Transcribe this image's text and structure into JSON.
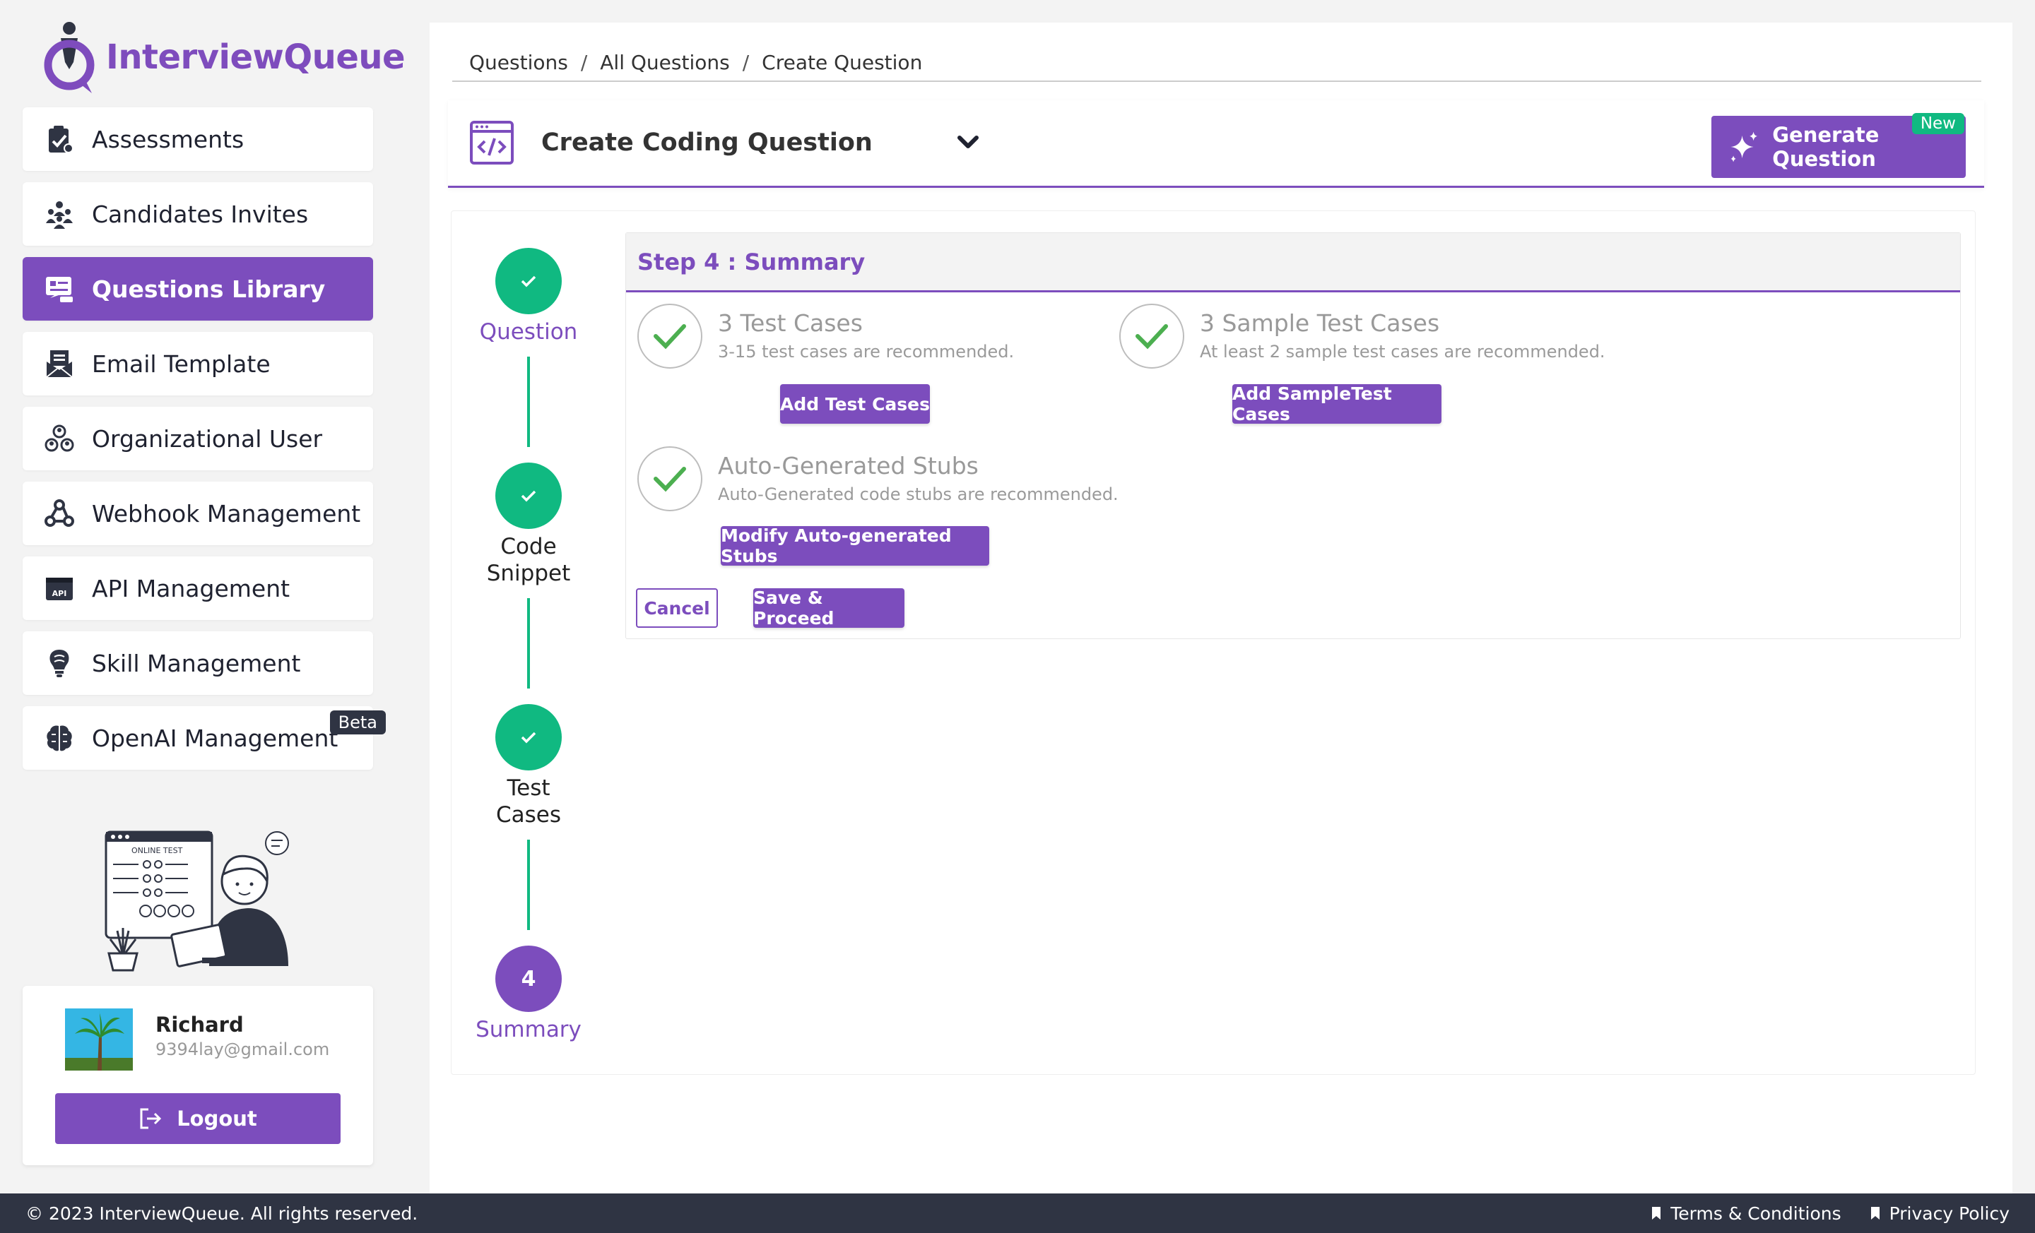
{
  "app": {
    "name": "InterviewQueue",
    "brand_color": "#7c4dbd",
    "success_color": "#10b981"
  },
  "sidebar": {
    "items": [
      {
        "label": "Assessments",
        "icon": "clipboard-check-icon"
      },
      {
        "label": "Candidates Invites",
        "icon": "people-group-icon"
      },
      {
        "label": "Questions Library",
        "icon": "question-list-icon",
        "active": true
      },
      {
        "label": "Email Template",
        "icon": "mail-icon"
      },
      {
        "label": "Organizational User",
        "icon": "org-users-icon"
      },
      {
        "label": "Webhook Management",
        "icon": "webhook-icon"
      },
      {
        "label": "API Management",
        "icon": "api-icon"
      },
      {
        "label": "Skill Management",
        "icon": "lightbulb-brain-icon"
      },
      {
        "label": "OpenAI Management",
        "icon": "openai-brain-icon",
        "badge": "Beta"
      }
    ],
    "illustration_text": "ONLINE TEST"
  },
  "user": {
    "name": "Richard",
    "email": "9394lay@gmail.com",
    "logout_label": "Logout"
  },
  "breadcrumb": [
    "Questions",
    "All Questions",
    "Create Question"
  ],
  "header": {
    "title": "Create Coding Question",
    "generate_label": "Generate Question",
    "new_badge": "New"
  },
  "steps": [
    {
      "label_line1": "Question",
      "label_line2": "",
      "state": "done"
    },
    {
      "label_line1": "Code",
      "label_line2": "Snippet",
      "state": "done"
    },
    {
      "label_line1": "Test",
      "label_line2": "Cases",
      "state": "done"
    },
    {
      "label_line1": "Summary",
      "label_line2": "",
      "number": "4",
      "state": "current"
    }
  ],
  "summary": {
    "heading": "Step 4 : Summary",
    "items": [
      {
        "title": "3 Test Cases",
        "subtitle": "3-15 test cases are recommended.",
        "button": "Add Test Cases"
      },
      {
        "title": "3 Sample Test Cases",
        "subtitle": "At least 2 sample test cases are recommended.",
        "button": "Add SampleTest Cases"
      },
      {
        "title": "Auto-Generated Stubs",
        "subtitle": "Auto-Generated code stubs are recommended.",
        "button": "Modify Auto-generated Stubs"
      }
    ],
    "cancel_label": "Cancel",
    "save_label": "Save & Proceed"
  },
  "footer": {
    "copyright": "© 2023 InterviewQueue. All rights reserved.",
    "links": [
      "Terms & Conditions",
      "Privacy Policy"
    ]
  }
}
